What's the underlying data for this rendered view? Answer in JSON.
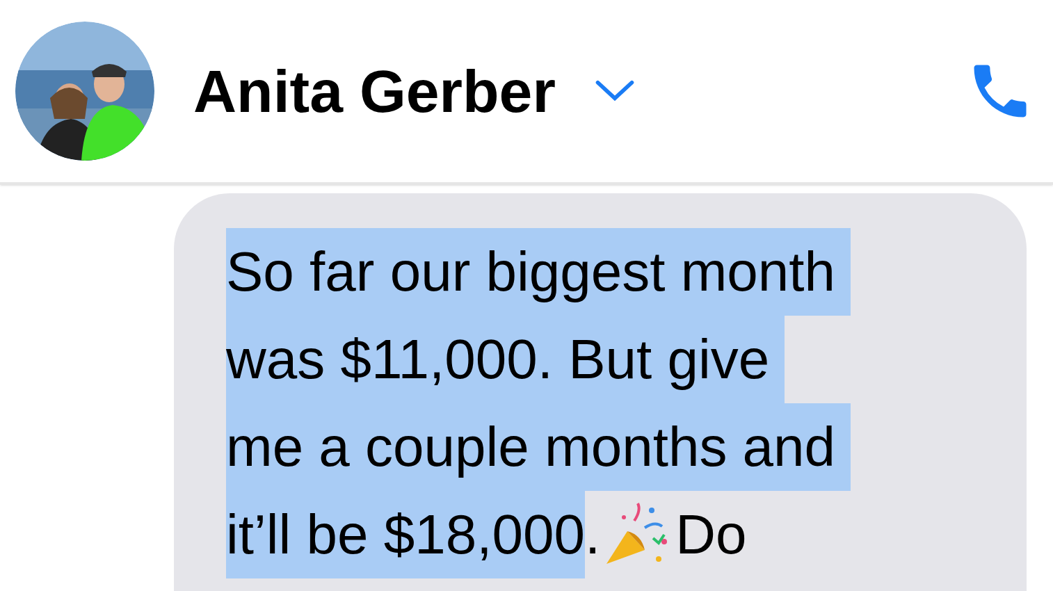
{
  "header": {
    "contact_name": "Anita Gerber"
  },
  "message": {
    "lines": [
      [
        {
          "text": "So far our biggest month ",
          "selected": true
        }
      ],
      [
        {
          "text": "was $11,000. But give ",
          "selected": true
        }
      ],
      [
        {
          "text": "me a couple months and ",
          "selected": true
        }
      ],
      [
        {
          "text": "it’ll be $18,000",
          "selected": true
        },
        {
          "text": ".",
          "selected": false
        },
        {
          "kind": "emoji"
        },
        {
          "text": "Do",
          "selected": false
        }
      ]
    ]
  }
}
